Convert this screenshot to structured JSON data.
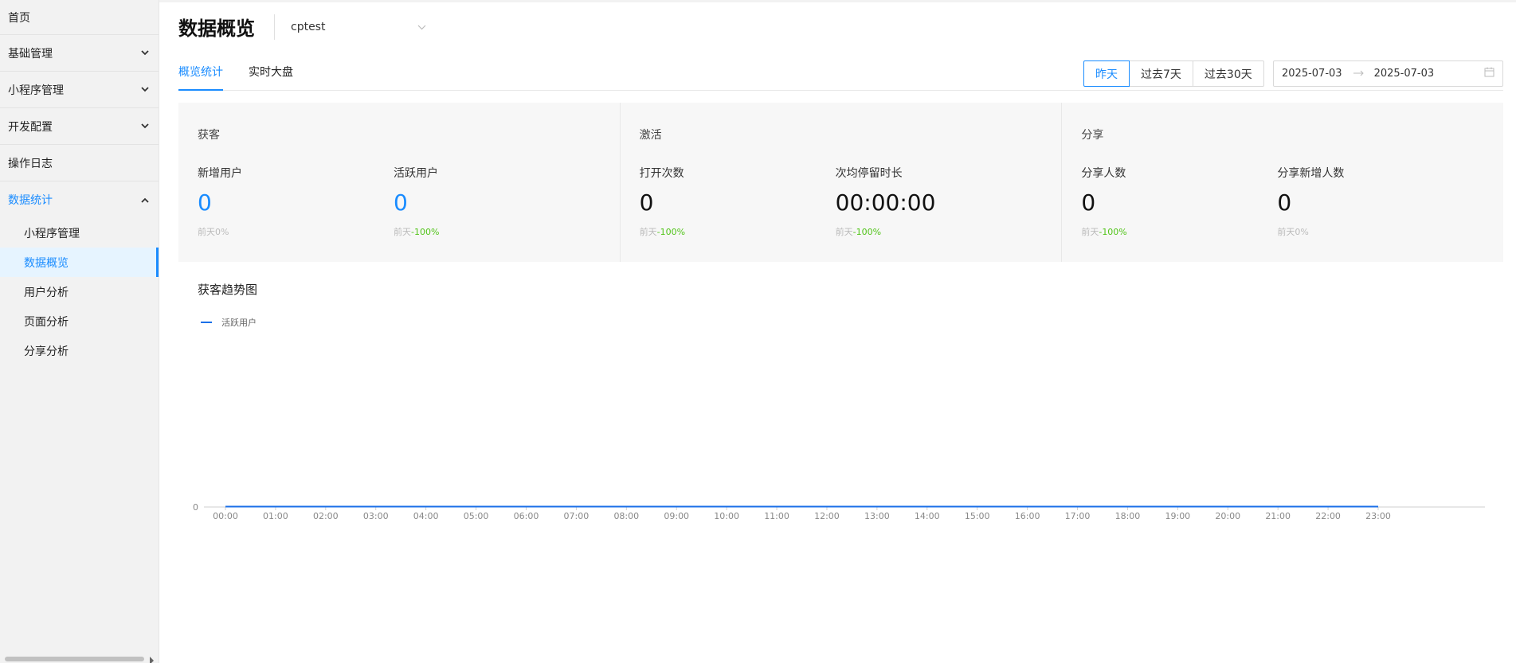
{
  "sidebar": {
    "items": [
      {
        "label": "首页"
      },
      {
        "label": "基础管理"
      },
      {
        "label": "小程序管理"
      },
      {
        "label": "开发配置"
      },
      {
        "label": "操作日志"
      },
      {
        "label": "数据统计"
      }
    ],
    "sub_items": [
      {
        "label": "小程序管理"
      },
      {
        "label": "数据概览"
      },
      {
        "label": "用户分析"
      },
      {
        "label": "页面分析"
      },
      {
        "label": "分享分析"
      }
    ]
  },
  "header": {
    "title": "数据概览",
    "app_select_value": "cptest"
  },
  "tabs": [
    {
      "label": "概览统计"
    },
    {
      "label": "实时大盘"
    }
  ],
  "range_buttons": [
    {
      "label": "昨天"
    },
    {
      "label": "过去7天"
    },
    {
      "label": "过去30天"
    }
  ],
  "date_range": {
    "start": "2025-07-03",
    "end": "2025-07-03"
  },
  "panels": [
    {
      "title": "获客",
      "metrics": [
        {
          "label": "新增用户",
          "value": "0",
          "cmp_prefix": "前天",
          "cmp_value": "0%"
        },
        {
          "label": "活跃用户",
          "value": "0",
          "cmp_prefix": "前天",
          "cmp_value": "-100%"
        }
      ]
    },
    {
      "title": "激活",
      "metrics": [
        {
          "label": "打开次数",
          "value": "0",
          "cmp_prefix": "前天",
          "cmp_value": "-100%"
        },
        {
          "label": "次均停留时长",
          "value": "00:00:00",
          "cmp_prefix": "前天",
          "cmp_value": "-100%"
        }
      ]
    },
    {
      "title": "分享",
      "metrics": [
        {
          "label": "分享人数",
          "value": "0",
          "cmp_prefix": "前天",
          "cmp_value": "-100%"
        },
        {
          "label": "分享新增人数",
          "value": "0",
          "cmp_prefix": "前天",
          "cmp_value": "0%"
        }
      ]
    }
  ],
  "chart_data": {
    "type": "line",
    "title": "获客趋势图",
    "x": [
      "00:00",
      "01:00",
      "02:00",
      "03:00",
      "04:00",
      "05:00",
      "06:00",
      "07:00",
      "08:00",
      "09:00",
      "10:00",
      "11:00",
      "12:00",
      "13:00",
      "14:00",
      "15:00",
      "16:00",
      "17:00",
      "18:00",
      "19:00",
      "20:00",
      "21:00",
      "22:00",
      "23:00"
    ],
    "series": [
      {
        "name": "活跃用户",
        "values": [
          0,
          0,
          0,
          0,
          0,
          0,
          0,
          0,
          0,
          0,
          0,
          0,
          0,
          0,
          0,
          0,
          0,
          0,
          0,
          0,
          0,
          0,
          0,
          0
        ],
        "color": "#1a6fe8"
      }
    ],
    "yticks": [
      "0"
    ],
    "legend": "top-left",
    "grid": false
  },
  "colors": {
    "accent": "#1a8cff",
    "positive": "#52c41a"
  }
}
